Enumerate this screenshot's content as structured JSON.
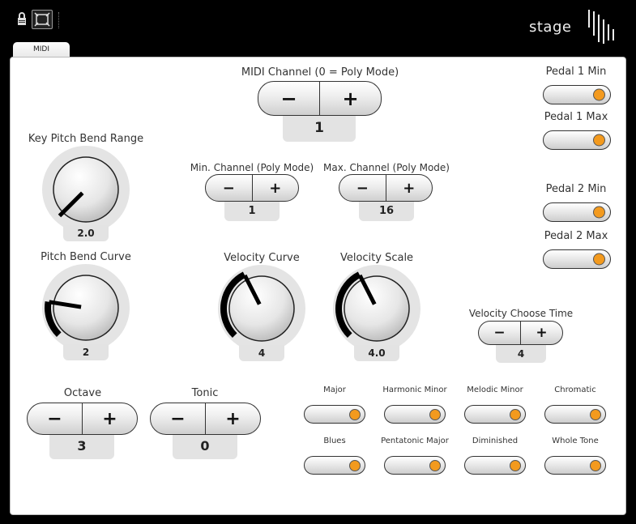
{
  "app": {
    "brand": "stage"
  },
  "toolbar": {
    "lock_icon": "lock-icon",
    "fit_icon": "fit-screen-icon"
  },
  "tabs": [
    {
      "label": "MIDI",
      "active": true
    }
  ],
  "midi_channel": {
    "label": "MIDI Channel (0 = Poly Mode)",
    "minus": "−",
    "plus": "+",
    "value": "1"
  },
  "min_channel": {
    "label": "Min. Channel (Poly Mode)",
    "minus": "−",
    "plus": "+",
    "value": "1"
  },
  "max_channel": {
    "label": "Max. Channel (Poly Mode)",
    "minus": "−",
    "plus": "+",
    "value": "16"
  },
  "knobs": {
    "key_pitch_bend_range": {
      "label": "Key Pitch Bend Range",
      "value": "2.0",
      "level": 0.0
    },
    "pitch_bend_curve": {
      "label": "Pitch Bend Curve",
      "value": "2",
      "level": 0.2
    },
    "velocity_curve": {
      "label": "Velocity Curve",
      "value": "4",
      "level": 0.4
    },
    "velocity_scale": {
      "label": "Velocity Scale",
      "value": "4.0",
      "level": 0.4
    }
  },
  "velocity_choose_time": {
    "label": "Velocity Choose Time",
    "minus": "−",
    "plus": "+",
    "value": "4"
  },
  "octave": {
    "label": "Octave",
    "minus": "−",
    "plus": "+",
    "value": "3"
  },
  "tonic": {
    "label": "Tonic",
    "minus": "−",
    "plus": "+",
    "value": "0"
  },
  "pedals": [
    {
      "label": "Pedal 1 Min",
      "on": true
    },
    {
      "label": "Pedal 1 Max",
      "on": true
    },
    {
      "label": "Pedal 2 Min",
      "on": true
    },
    {
      "label": "Pedal 2 Max",
      "on": true
    }
  ],
  "scales": [
    {
      "label": "Major",
      "on": true
    },
    {
      "label": "Harmonic Minor",
      "on": true
    },
    {
      "label": "Melodic Minor",
      "on": true
    },
    {
      "label": "Chromatic",
      "on": true
    },
    {
      "label": "Blues",
      "on": true
    },
    {
      "label": "Pentatonic Major",
      "on": true
    },
    {
      "label": "Diminished",
      "on": true
    },
    {
      "label": "Whole Tone",
      "on": true
    }
  ],
  "colors": {
    "accent": "#f39a1e",
    "arc": "#000000",
    "panel": "#ffffff",
    "background": "#000000"
  }
}
